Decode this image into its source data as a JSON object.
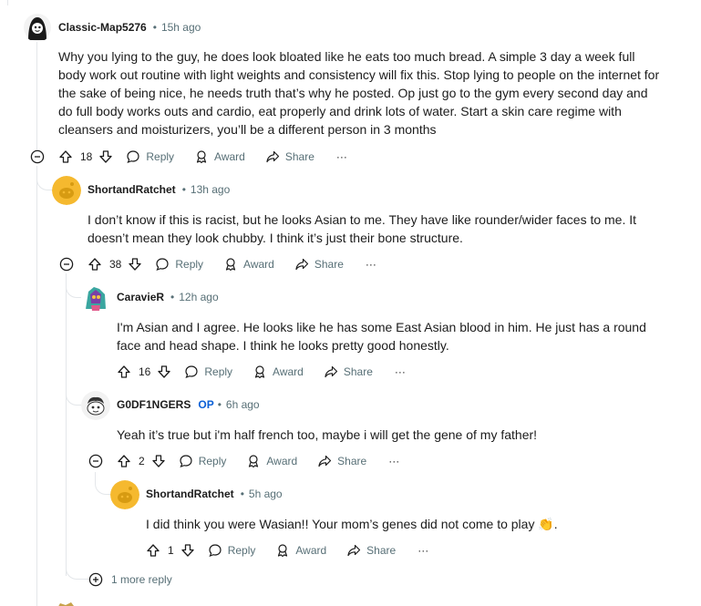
{
  "comments": [
    {
      "user": "Classic-Map5276",
      "time": "15h ago",
      "body": "Why you lying to the guy, he does look bloated like he eats too much bread. A simple 3 day a week full body work out routine with light weights and consistency will fix this. Stop lying to people on the internet for the sake of being nice, he needs truth that’s why he posted. Op just go to the gym every second day and do full body works outs and cardio, eat properly and drink lots of water. Start a skin care regime with cleansers and moisturizers, you’ll be a different person in 3 months",
      "votes": "18"
    },
    {
      "user": "ShortandRatchet",
      "time": "13h ago",
      "body": "I don’t know if this is racist, but he looks Asian to me. They have like rounder/wider faces to me. It doesn’t mean they look chubby. I think it’s just their bone structure.",
      "votes": "38"
    },
    {
      "user": "CaravieR",
      "time": "12h ago",
      "body": "I'm Asian and I agree. He looks like he has some East Asian blood in him. He just has a round face and head shape. I think he looks pretty good honestly.",
      "votes": "16"
    },
    {
      "user": "G0DF1NGERS",
      "op_badge": "OP",
      "time": "6h ago",
      "body": "Yeah it’s true but i'm half french too, maybe i will get the gene of my father!",
      "votes": "2"
    },
    {
      "user": "ShortandRatchet",
      "time": "5h ago",
      "body": "I did think you were Wasian!! Your mom’s genes did not come to play 👏.",
      "votes": "1"
    }
  ],
  "actions": {
    "reply": "Reply",
    "award": "Award",
    "share": "Share",
    "more": "···"
  },
  "more_replies": "1 more reply",
  "colors": {
    "text": "#1c1c1c",
    "meta": "#576f76",
    "op": "#0a5fd6",
    "thread_line": "#e4e7ea",
    "snoo_yellow": "#f5b92f"
  }
}
